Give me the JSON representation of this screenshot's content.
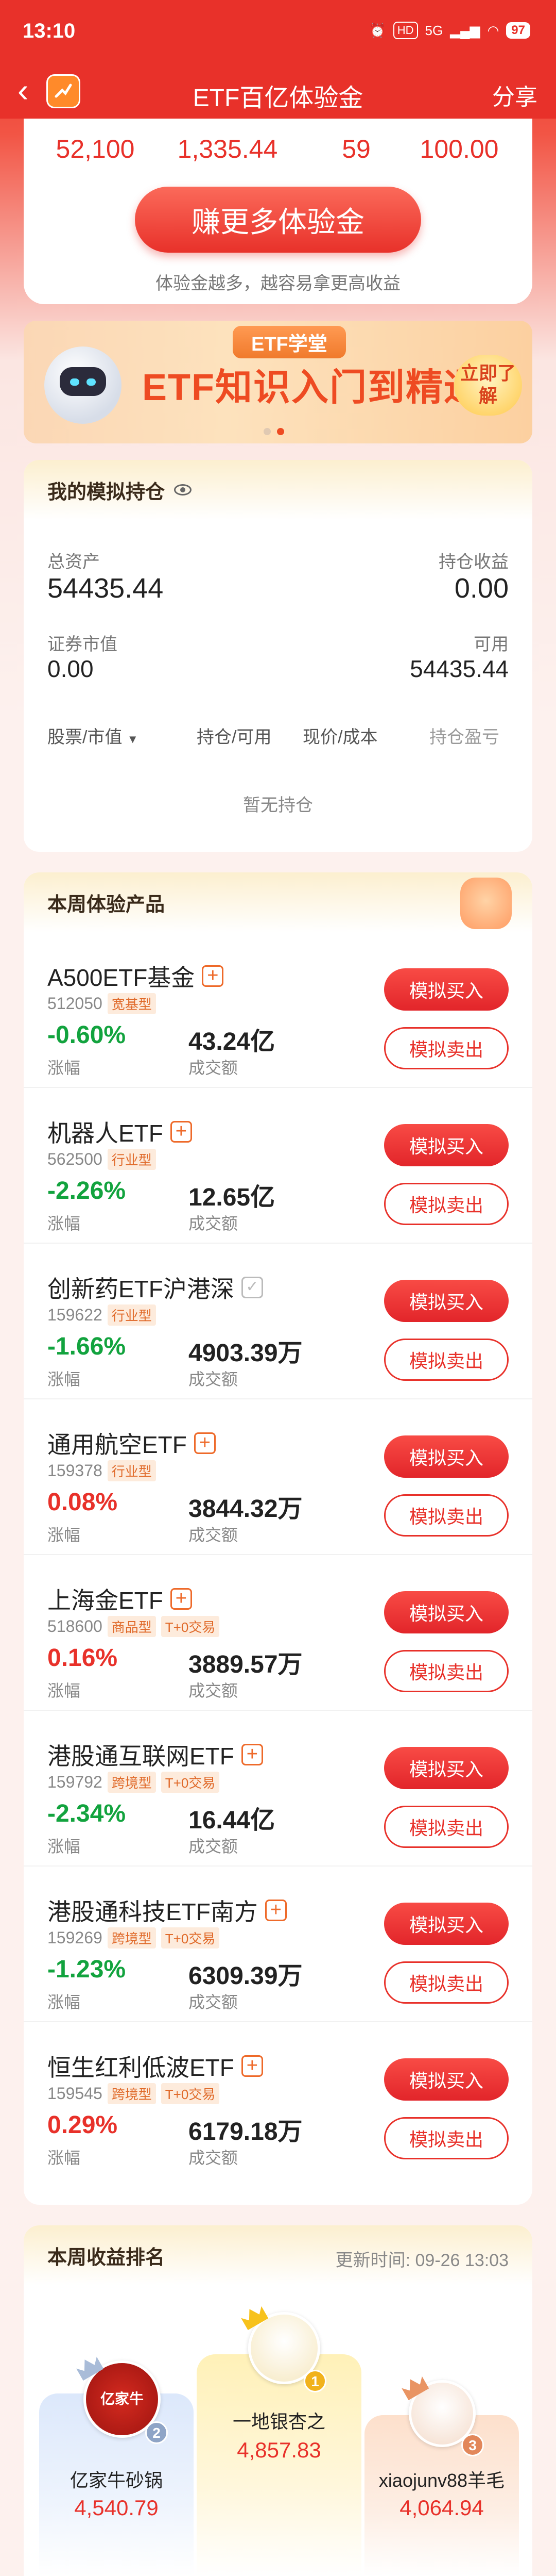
{
  "status_bar": {
    "time": "13:10",
    "network": "5G",
    "hd": "HD",
    "battery": "97"
  },
  "header": {
    "title": "ETF百亿体验金",
    "share": "分享"
  },
  "stats": {
    "values": [
      "52,100",
      "1,335.44",
      "59",
      "100.00"
    ]
  },
  "earn": {
    "button": "赚更多体验金",
    "tip": "体验金越多，越容易拿更高收益"
  },
  "banner": {
    "tag": "ETF学堂",
    "headline": "ETF知识入门到精通",
    "cta": "立即了解"
  },
  "holdings": {
    "title": "我的模拟持仓",
    "total_assets_label": "总资产",
    "total_assets": "54435.44",
    "profit_label": "持仓收益",
    "profit": "0.00",
    "market_value_label": "证券市值",
    "market_value": "0.00",
    "available_label": "可用",
    "available": "54435.44",
    "columns": [
      "股票/市值",
      "持仓/可用",
      "现价/成本",
      "持仓盈亏"
    ],
    "empty": "暂无持仓"
  },
  "products": {
    "title": "本周体验产品",
    "change_label": "涨幅",
    "volume_label": "成交额",
    "buy_label": "模拟买入",
    "sell_label": "模拟卖出",
    "items": [
      {
        "name": "A500ETF基金",
        "code": "512050",
        "tags": [
          "宽基型"
        ],
        "change": "-0.60%",
        "direction": "down",
        "volume": "43.24亿",
        "added": false
      },
      {
        "name": "机器人ETF",
        "code": "562500",
        "tags": [
          "行业型"
        ],
        "change": "-2.26%",
        "direction": "down",
        "volume": "12.65亿",
        "added": false
      },
      {
        "name": "创新药ETF沪港深",
        "code": "159622",
        "tags": [
          "行业型"
        ],
        "change": "-1.66%",
        "direction": "down",
        "volume": "4903.39万",
        "added": true
      },
      {
        "name": "通用航空ETF",
        "code": "159378",
        "tags": [
          "行业型"
        ],
        "change": "0.08%",
        "direction": "up",
        "volume": "3844.32万",
        "added": false
      },
      {
        "name": "上海金ETF",
        "code": "518600",
        "tags": [
          "商品型",
          "T+0交易"
        ],
        "change": "0.16%",
        "direction": "up",
        "volume": "3889.57万",
        "added": false
      },
      {
        "name": "港股通互联网ETF",
        "code": "159792",
        "tags": [
          "跨境型",
          "T+0交易"
        ],
        "change": "-2.34%",
        "direction": "down",
        "volume": "16.44亿",
        "added": false
      },
      {
        "name": "港股通科技ETF南方",
        "code": "159269",
        "tags": [
          "跨境型",
          "T+0交易"
        ],
        "change": "-1.23%",
        "direction": "down",
        "volume": "6309.39万",
        "added": false
      },
      {
        "name": "恒生红利低波ETF",
        "code": "159545",
        "tags": [
          "跨境型",
          "T+0交易"
        ],
        "change": "0.29%",
        "direction": "up",
        "volume": "6179.18万",
        "added": false
      }
    ]
  },
  "ranking": {
    "title": "本周收益排名",
    "updated": "更新时间: 09-26 13:03",
    "first": {
      "rank": "1",
      "name": "一地银杏之",
      "value": "4,857.83"
    },
    "second": {
      "rank": "2",
      "name": "亿家牛砂锅",
      "value": "4,540.79",
      "avatar_text": "亿家牛"
    },
    "third": {
      "rank": "3",
      "name": "xiaojunv88羊毛",
      "value": "4,064.94"
    }
  },
  "colors": {
    "brand_red": "#e8312a",
    "down_green": "#12a33e",
    "accent_orange": "#ee6a2a"
  }
}
